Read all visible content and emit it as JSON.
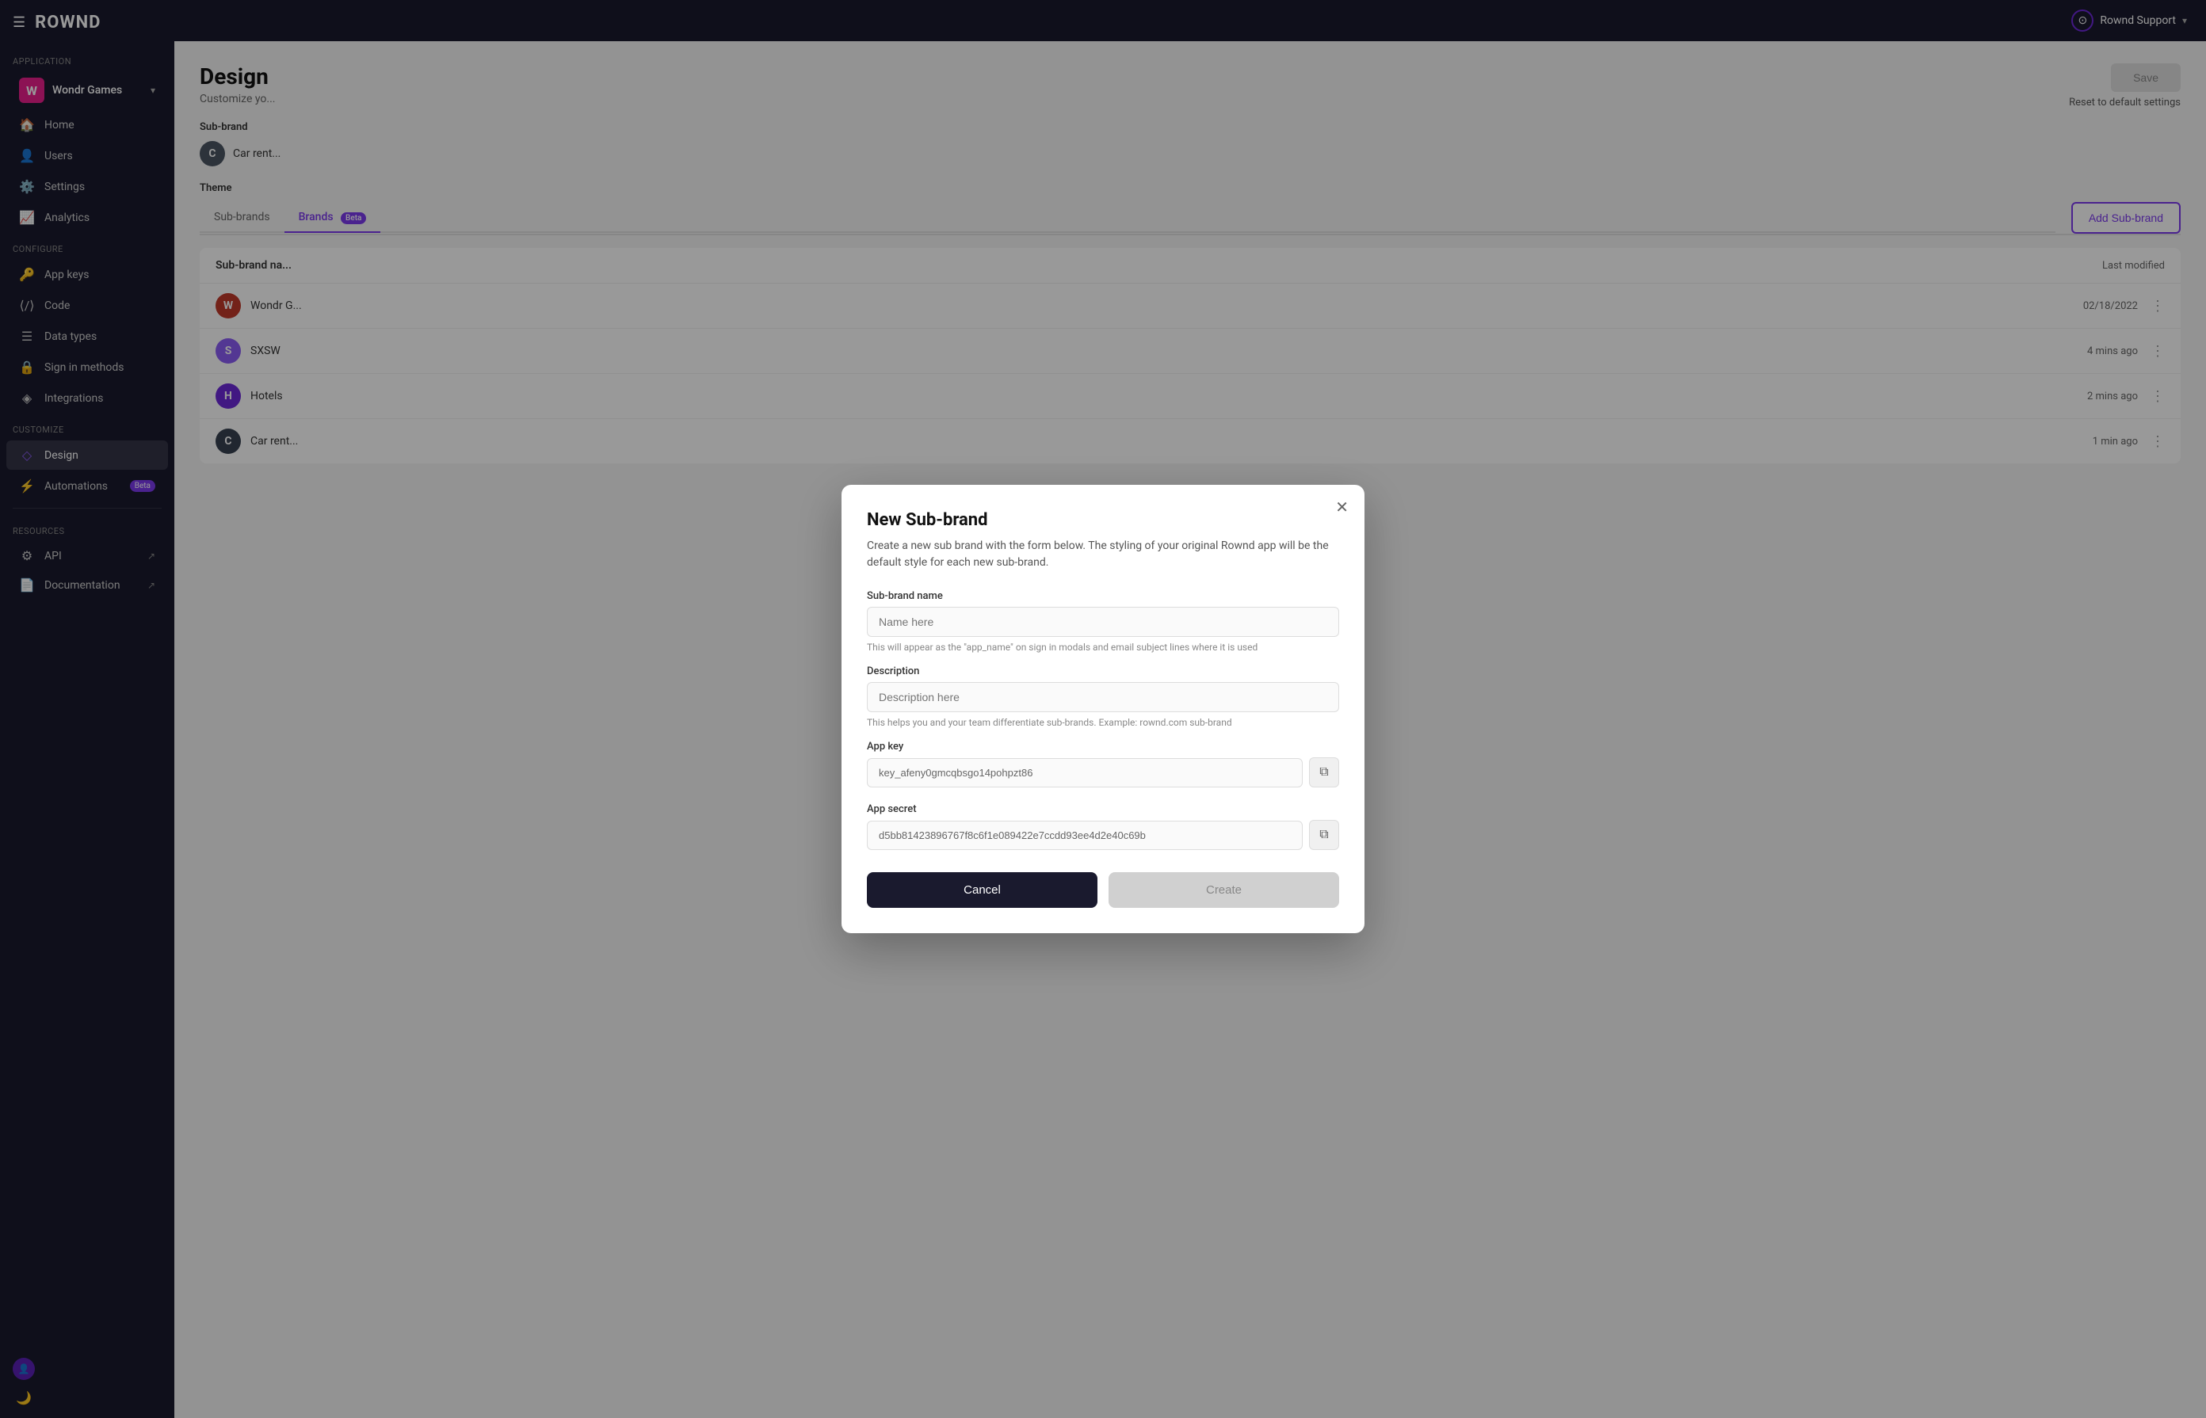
{
  "header": {
    "logo": "ROWND",
    "user": "Rownd Support",
    "user_icon": "👤"
  },
  "sidebar": {
    "app_section_label": "Application",
    "app_name": "Wondr Games",
    "app_icon_letter": "W",
    "nav_items": [
      {
        "id": "home",
        "label": "Home",
        "icon": "🏠",
        "active": false
      },
      {
        "id": "users",
        "label": "Users",
        "icon": "👤",
        "active": false
      },
      {
        "id": "settings",
        "label": "Settings",
        "icon": "⚙️",
        "active": false
      },
      {
        "id": "analytics",
        "label": "Analytics",
        "icon": "📈",
        "active": false
      }
    ],
    "configure_label": "Configure",
    "configure_items": [
      {
        "id": "app-keys",
        "label": "App keys",
        "icon": "🔑"
      },
      {
        "id": "code",
        "label": "Code",
        "icon": "⟨⟩"
      },
      {
        "id": "data-types",
        "label": "Data types",
        "icon": "☰"
      },
      {
        "id": "sign-in-methods",
        "label": "Sign in methods",
        "icon": "🔒"
      },
      {
        "id": "integrations",
        "label": "Integrations",
        "icon": "◈"
      }
    ],
    "customize_label": "Customize",
    "customize_items": [
      {
        "id": "design",
        "label": "Design",
        "icon": "◇",
        "active": true
      },
      {
        "id": "automations",
        "label": "Automations",
        "icon": "⚡",
        "beta": true
      }
    ],
    "resources_label": "Resources",
    "resources_items": [
      {
        "id": "api",
        "label": "API",
        "icon": "⚙"
      },
      {
        "id": "documentation",
        "label": "Documentation",
        "icon": "📄"
      }
    ]
  },
  "page": {
    "title": "Design",
    "subtitle": "Customize yo...",
    "save_button": "Save",
    "reset_link": "Reset to default settings",
    "subbrand_section": "Sub-brand",
    "subbrand_current": "Car rent...",
    "subbrand_icon": "C",
    "theme_section": "Theme",
    "tabs": [
      {
        "label": "Sub-brands",
        "active": false
      },
      {
        "label": "Brands",
        "active": true,
        "badge": "Beta"
      }
    ],
    "add_subbrand_btn": "Add Sub-brand",
    "table": {
      "name_col": "Sub-brand na...",
      "last_mod_col": "Last modified",
      "rows": [
        {
          "icon": "W",
          "icon_bg": "#c0392b",
          "name": "Wondr G...",
          "date": "02/18/2022"
        },
        {
          "icon": "S",
          "icon_bg": "#8b5cf6",
          "name": "SXSW",
          "date": "4 mins ago"
        },
        {
          "icon": "H",
          "icon_bg": "#6d28d9",
          "name": "Hotels",
          "date": "2 mins ago"
        },
        {
          "icon": "C",
          "icon_bg": "#374151",
          "name": "Car rent...",
          "date": "1 min ago"
        }
      ]
    }
  },
  "modal": {
    "title": "New Sub-brand",
    "description": "Create a new sub brand with the form below. The styling of your original Rownd app will be the default style for each new sub-brand.",
    "subbrand_name_label": "Sub-brand name",
    "subbrand_name_placeholder": "Name here",
    "subbrand_name_hint": "This will appear as the \"app_name\" on sign in modals and email subject lines where it is used",
    "description_label": "Description",
    "description_placeholder": "Description here",
    "description_hint": "This helps you and your team differentiate sub-brands. Example: rownd.com sub-brand",
    "app_key_label": "App key",
    "app_key_value": "key_afeny0gmcqbsgo14pohpzt86",
    "app_secret_label": "App secret",
    "app_secret_value": "d5bb81423896767f8c6f1e089422e7ccdd93ee4d2e40c69b",
    "cancel_btn": "Cancel",
    "create_btn": "Create"
  }
}
